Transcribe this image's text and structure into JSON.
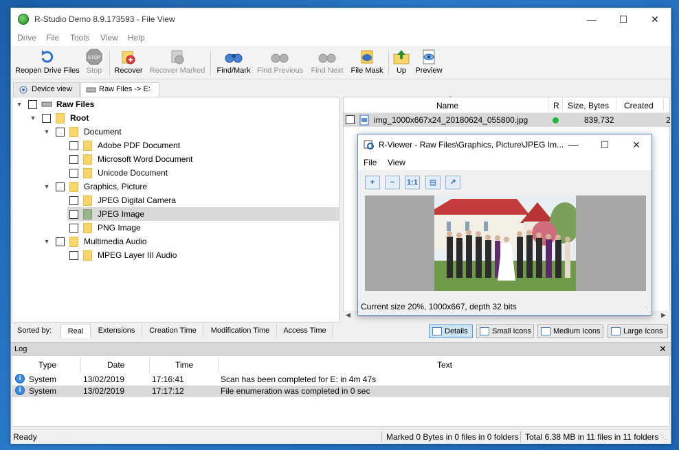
{
  "window": {
    "title": "R-Studio Demo 8.9.173593 - File View",
    "controls": [
      "—",
      "☐",
      "✕"
    ]
  },
  "menu": [
    "Drive",
    "File",
    "Tools",
    "View",
    "Help"
  ],
  "toolbar": {
    "reopen": "Reopen Drive Files",
    "stop": "Stop",
    "recover": "Recover",
    "recover_marked": "Recover Marked",
    "find_mark": "Find/Mark",
    "find_previous": "Find Previous",
    "find_next": "Find Next",
    "file_mask": "File Mask",
    "up": "Up",
    "preview": "Preview",
    "stop_icon_text": "STOP"
  },
  "tabs": {
    "device_view": "Device view",
    "raw_files": "Raw Files -> E:"
  },
  "tree": {
    "raw_files": "Raw Files",
    "root": "Root",
    "document": "Document",
    "adobe_pdf": "Adobe PDF Document",
    "ms_word": "Microsoft Word Document",
    "unicode": "Unicode Document",
    "graphics": "Graphics, Picture",
    "jpeg_camera": "JPEG Digital Camera",
    "jpeg_image": "JPEG Image",
    "png": "PNG Image",
    "multimedia": "Multimedia Audio",
    "mpeg": "MPEG Layer III Audio"
  },
  "file_list": {
    "columns": {
      "name": "Name",
      "r": "R",
      "size": "Size, Bytes",
      "created": "Created"
    },
    "row": {
      "name": "img_1000x667x24_20180624_055800.jpg",
      "size": "839,732",
      "created_partial": "2"
    },
    "status_color": "#1bb83a"
  },
  "viewer": {
    "title": "R-Viewer - Raw Files\\Graphics, Picture\\JPEG Im...",
    "menu": {
      "file": "File",
      "view": "View"
    },
    "tools": {
      "fit": "1:1"
    },
    "status": "Current size 20%, 1000x667, depth 32 bits"
  },
  "sort": {
    "label": "Sorted by:",
    "tabs": {
      "real": "Real",
      "extensions": "Extensions",
      "creation": "Creation Time",
      "modification": "Modification Time",
      "access": "Access Time"
    },
    "views": {
      "details": "Details",
      "small": "Small Icons",
      "medium": "Medium Icons",
      "large": "Large Icons"
    }
  },
  "log": {
    "title": "Log",
    "columns": {
      "type": "Type",
      "date": "Date",
      "time": "Time",
      "text": "Text"
    },
    "rows": [
      {
        "type": "System",
        "date": "13/02/2019",
        "time": "17:16:41",
        "text": "Scan has been completed for E: in 4m 47s"
      },
      {
        "type": "System",
        "date": "13/02/2019",
        "time": "17:17:12",
        "text": "File enumeration was completed in 0 sec"
      }
    ]
  },
  "status": {
    "ready": "Ready",
    "marked": "Marked 0 Bytes in 0 files in 0 folders",
    "total": "Total 6.38 MB in 11 files in 11 folders"
  }
}
